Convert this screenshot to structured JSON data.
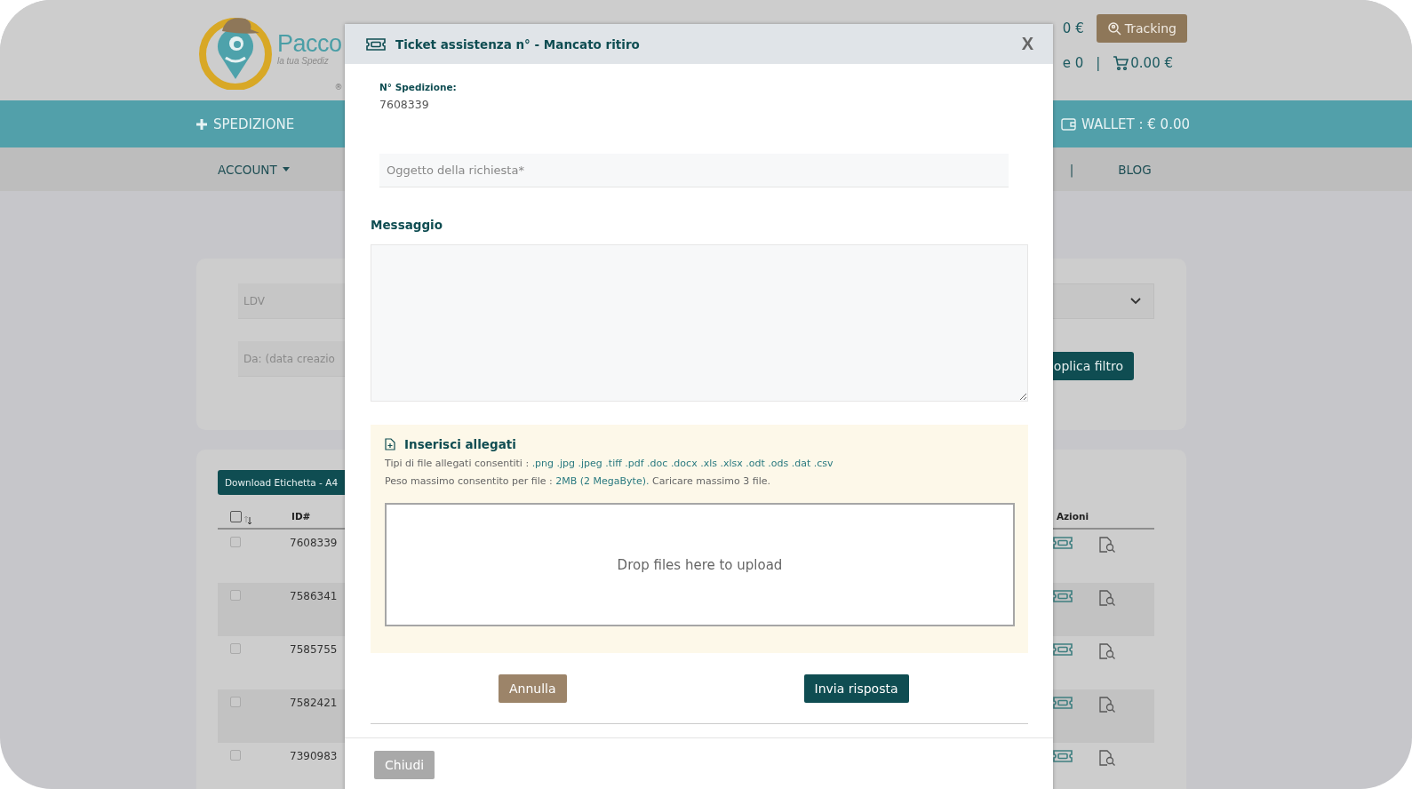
{
  "header": {
    "logo": {
      "name": "Pacco",
      "tagline": "la tua Spediz",
      "mark": "®"
    },
    "balance_fragment": "0 €",
    "tracking_button": "Tracking",
    "counter_fragment": "e 0",
    "separator": "|",
    "cart_total": "0.00 €"
  },
  "nav": {
    "new_shipment": "SPEDIZIONE",
    "wallet": "WALLET : € 0.00"
  },
  "subnav": {
    "items": [
      {
        "label": "ACCOUNT",
        "dropdown": true
      },
      {
        "label": "BLOG",
        "dropdown": false
      }
    ],
    "separator": "|"
  },
  "filters": {
    "fields": [
      {
        "placeholder": "LDV"
      },
      {
        "placeholder": "Da: (data creazio"
      }
    ],
    "apply_button": "oplica filtro"
  },
  "table": {
    "download_button": "Download Etichetta - A4",
    "header_checked": false,
    "columns": [
      "ID#",
      "Azioni"
    ],
    "rows": [
      {
        "id": "7608339",
        "checked": false
      },
      {
        "id": "7586341",
        "checked": false
      },
      {
        "id": "7585755",
        "checked": false
      },
      {
        "id": "7582421",
        "checked": false
      },
      {
        "id": "7390983",
        "checked": false
      }
    ]
  },
  "modal": {
    "title": "Ticket assistenza n° - Mancato ritiro",
    "close": "X",
    "shipment_label": "N° Spedizione:",
    "shipment_number": "7608339",
    "subject_placeholder": "Oggetto della richiesta*",
    "message_label": "Messaggio",
    "attachments": {
      "title": "Inserisci allegati",
      "types_label": "Tipi di file allegati consentiti :",
      "types": ".png .jpg .jpeg .tiff .pdf .doc .docx .xls .xlsx .odt .ods .dat .csv",
      "size_label": "Peso massimo consentito per file :",
      "size": "2MB (2 MegaByte).",
      "size_note": "Caricare massimo 3 file.",
      "dropzone": "Drop files here to upload"
    },
    "cancel_button": "Annulla",
    "send_button": "Invia risposta",
    "close_button": "Chiudi"
  }
}
